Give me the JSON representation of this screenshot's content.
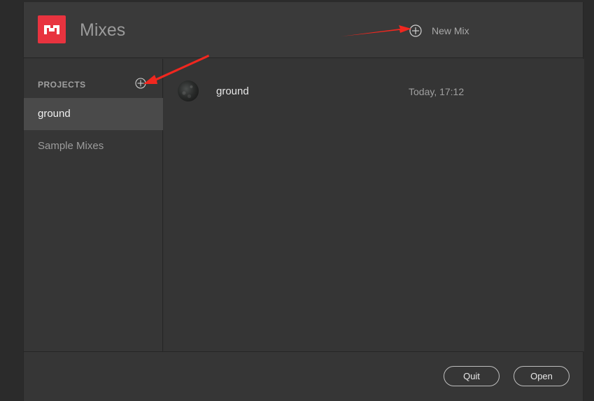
{
  "header": {
    "title": "Mixes",
    "logo_icon": "mixamo-logo-icon",
    "new_mix_label": "New Mix",
    "new_mix_icon": "plus-circle-icon",
    "brand_color": "#e8333f"
  },
  "sidebar": {
    "section_title": "PROJECTS",
    "add_icon": "plus-circle-icon",
    "items": [
      {
        "label": "ground",
        "selected": true
      },
      {
        "label": "Sample Mixes",
        "selected": false
      }
    ]
  },
  "mixes": [
    {
      "name": "ground",
      "date": "Today, 17:12",
      "thumbnail": "mix-thumbnail"
    }
  ],
  "footer": {
    "quit_label": "Quit",
    "open_label": "Open"
  },
  "annotations": {
    "arrow_color": "#f0271f"
  }
}
